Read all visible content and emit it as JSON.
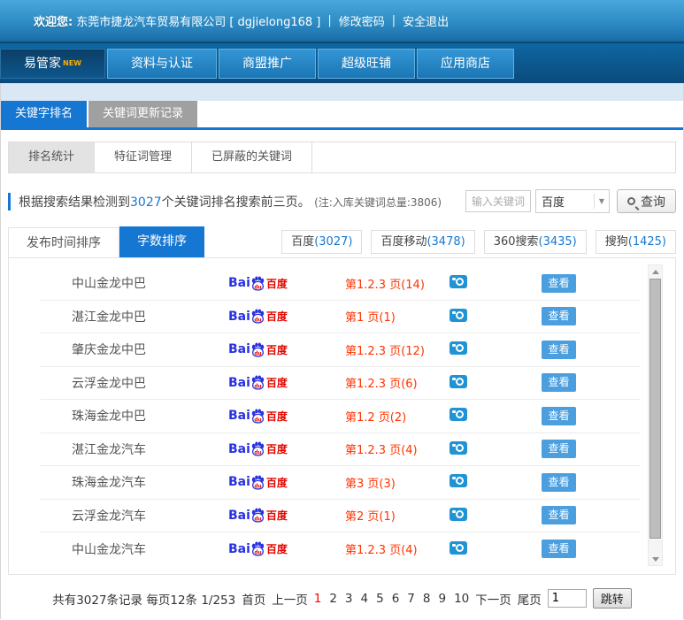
{
  "header": {
    "welcome_label": "欢迎您:",
    "company": "东莞市捷龙汽车贸易有限公司 [ dgjielong168 ]",
    "sep": "|",
    "change_password": "修改密码",
    "logout": "安全退出"
  },
  "nav": {
    "items": [
      {
        "label": "易管家",
        "badge": "NEW",
        "active": true
      },
      {
        "label": "资料与认证"
      },
      {
        "label": "商盟推广"
      },
      {
        "label": "超级旺铺"
      },
      {
        "label": "应用商店"
      }
    ]
  },
  "tabs": {
    "items": [
      {
        "label": "关键字排名",
        "active": true
      },
      {
        "label": "关键词更新记录"
      }
    ]
  },
  "subtabs": {
    "items": [
      {
        "label": "排名统计",
        "active": true
      },
      {
        "label": "特征词管理"
      },
      {
        "label": "已屏蔽的关键词"
      }
    ]
  },
  "summary": {
    "prefix": "根据搜索结果检测到",
    "count": "3027",
    "suffix": "个关键词排名搜索前三页。",
    "note": "(注:入库关键词总量:3806)"
  },
  "search": {
    "placeholder": "输入关键词",
    "engine_selected": "百度",
    "button_label": "查询"
  },
  "sort_tabs": {
    "items": [
      {
        "label": "发布时间排序"
      },
      {
        "label": "字数排序",
        "active": true
      }
    ]
  },
  "engine_filters": [
    {
      "name": "百度",
      "count": "(3027)"
    },
    {
      "name": "百度移动",
      "count": "(3478)"
    },
    {
      "name": "360搜索",
      "count": "(3435)"
    },
    {
      "name": "搜狗",
      "count": "(1425)"
    }
  ],
  "table": {
    "view_label": "查看",
    "baidu_logo": {
      "bai": "Bai",
      "du": "du",
      "cn": "百度"
    },
    "rows": [
      {
        "keyword": "中山金龙中巴",
        "rank": "第1.2.3 页(14)"
      },
      {
        "keyword": "湛江金龙中巴",
        "rank": "第1 页(1)"
      },
      {
        "keyword": "肇庆金龙中巴",
        "rank": "第1.2.3 页(12)"
      },
      {
        "keyword": "云浮金龙中巴",
        "rank": "第1.2.3 页(6)"
      },
      {
        "keyword": "珠海金龙中巴",
        "rank": "第1.2 页(2)"
      },
      {
        "keyword": "湛江金龙汽车",
        "rank": "第1.2.3 页(4)"
      },
      {
        "keyword": "珠海金龙汽车",
        "rank": "第3 页(3)"
      },
      {
        "keyword": "云浮金龙汽车",
        "rank": "第2 页(1)"
      },
      {
        "keyword": "中山金龙汽车",
        "rank": "第1.2.3 页(4)"
      }
    ]
  },
  "pagination": {
    "summary": "共有3027条记录 每页12条 1/253",
    "first": "首页",
    "prev": "上一页",
    "pages": [
      "1",
      "2",
      "3",
      "4",
      "5",
      "6",
      "7",
      "8",
      "9",
      "10"
    ],
    "current": "1",
    "next": "下一页",
    "last": "尾页",
    "jump_value": "1",
    "jump_button": "跳转"
  },
  "colors": {
    "accent_blue": "#1677d2",
    "rank_red": "#ff3300",
    "view_button_blue": "#4b9fdf",
    "baidu_blue": "#2932e1",
    "baidu_red": "#e10600",
    "current_page_red": "#ff0000"
  }
}
